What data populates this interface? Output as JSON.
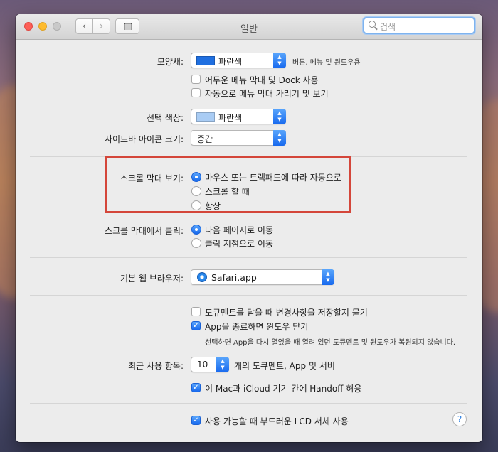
{
  "window": {
    "title": "일반"
  },
  "search": {
    "placeholder": "검색"
  },
  "appearance": {
    "label": "모양새:",
    "value": "파란색",
    "swatch_color": "#1f6fe0",
    "note": "버튼, 메뉴 및 윈도우용",
    "dark_menu": "어두운 메뉴 막대 및 Dock 사용",
    "auto_hide_menu": "자동으로 메뉴 막대 가리기 및 보기"
  },
  "highlight": {
    "label": "선택 색상:",
    "value": "파란색",
    "swatch_color": "#a9ccf4"
  },
  "sidebar_icon": {
    "label": "사이드바 아이콘 크기:",
    "value": "중간"
  },
  "scroll_bars": {
    "label": "스크롤 막대 보기:",
    "options": [
      "마우스 또는 트랙패드에 따라 자동으로",
      "스크롤 할 때",
      "항상"
    ],
    "selected": 0
  },
  "scroll_click": {
    "label": "스크롤 막대에서 클릭:",
    "options": [
      "다음 페이지로 이동",
      "클릭 지점으로 이동"
    ],
    "selected": 0
  },
  "browser": {
    "label": "기본 웹 브라우저:",
    "value": "Safari.app"
  },
  "documents": {
    "ask_keep_changes": "도큐멘트를 닫을 때 변경사항을 저장할지 묻기",
    "close_windows": "App을 종료하면 윈도우 닫기",
    "close_windows_note": "선택하면 App을 다시 열었을 때 열려 있던 도큐멘트 및 윈도우가 복원되지 않습니다."
  },
  "recent": {
    "label": "최근 사용 항목:",
    "value": "10",
    "suffix": "개의 도큐멘트, App 및 서버"
  },
  "handoff": "이 Mac과 iCloud 기기 간에 Handoff 허용",
  "lcd_font": "사용 가능할 때 부드러운 LCD 서체 사용",
  "help": "?"
}
